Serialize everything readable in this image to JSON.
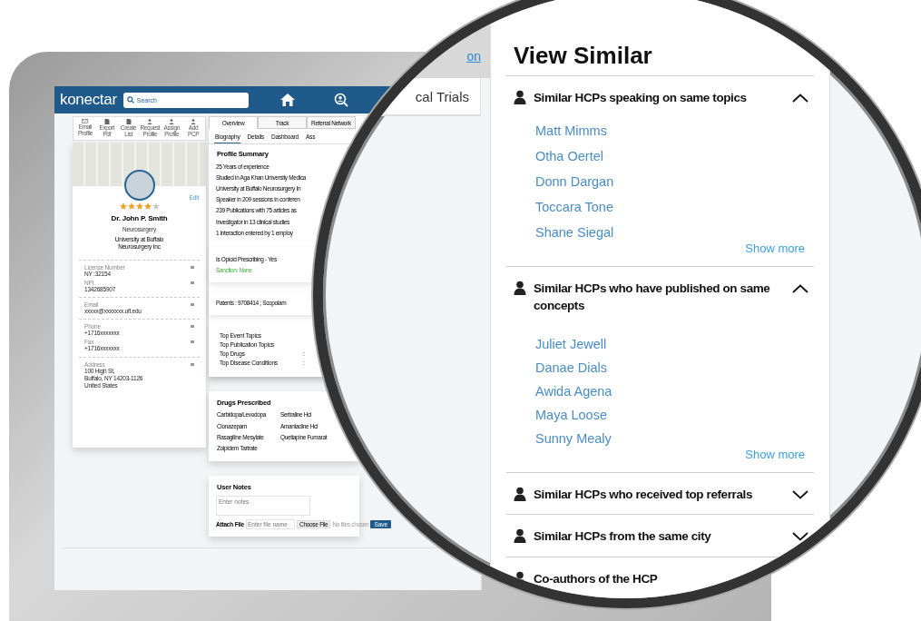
{
  "header": {
    "logo": "konectar",
    "search_placeholder": "Search"
  },
  "toolbar": [
    {
      "label": "Email Profile"
    },
    {
      "label": "Export Pdf"
    },
    {
      "label": "Create List"
    },
    {
      "label": "Request Profile"
    },
    {
      "label": "Assign Profile"
    },
    {
      "label": "Add PCP"
    }
  ],
  "profile": {
    "edit": "Edit",
    "stars": 4,
    "name": "Dr. John P. Smith",
    "specialty": "Neurosurgery",
    "organization": "University at Buffalo\nNeurosurgery Inc",
    "groups": [
      [
        {
          "label": "License Number",
          "value": "NY :32154"
        },
        {
          "label": "NPI",
          "value": "1342685907"
        }
      ],
      [
        {
          "label": "Email",
          "value": "xxxxx@xxxxxxx.ufl.edu"
        }
      ],
      [
        {
          "label": "Phone",
          "value": "+1716xxxxxxx"
        },
        {
          "label": "Fax",
          "value": "+1716xxxxxxx"
        }
      ],
      [
        {
          "label": "Address",
          "value": "100 High St,\nBuffalo, NY 14203-1126\nUnited States"
        }
      ]
    ]
  },
  "tabs": [
    {
      "label": "Overview",
      "selected": true
    },
    {
      "label": "Track",
      "selected": false
    },
    {
      "label": "Referral Network",
      "selected": false
    }
  ],
  "subtabs": [
    {
      "label": "Biography",
      "selected": true
    },
    {
      "label": "Details",
      "selected": false
    },
    {
      "label": "Dashboard",
      "selected": false
    },
    {
      "label": "Ass",
      "selected": false
    }
  ],
  "profile_summary": {
    "title": "Profile Summary",
    "items": [
      "25 Years of experience",
      "Studied in Aga Khan University Medica",
      "University at Buffalo Neurosurgery In",
      "Speaker in 209 sessions in conferen",
      "239 Publications with 75 articles as",
      "Investigator in 13 clinical studies",
      "1 interaction entered by 1 employ"
    ]
  },
  "flags": [
    {
      "text": "Is Opioid Prescribing - Yes",
      "kind": "normal"
    },
    {
      "text": "Sanction: None",
      "kind": "positive"
    }
  ],
  "patents": "Patents : 9708414 ; Scopolam",
  "top_lists": [
    {
      "label": "Top Event Topics"
    },
    {
      "label": "Top Publication Topics"
    },
    {
      "label": "Top Drugs",
      "value": ":"
    },
    {
      "label": "Top Disease Conditions",
      "value": ":"
    }
  ],
  "drugs": {
    "title": "Drugs Prescribed",
    "items": [
      "Carbidopa/Levodopa",
      "Sertraline Hcl",
      "Clonazepam",
      "Amantadine Hcl",
      "Rasagiline Mesylate",
      "Quetiapine Fumarat",
      "Zolpidem Tartrate"
    ]
  },
  "notes": {
    "title": "User Notes",
    "placeholder": "Enter notes",
    "attach_label": "Attach File",
    "file_placeholder": "Enter file name",
    "choose_button": "Choose File",
    "file_status": "No files chosen",
    "save_button": "Save"
  },
  "magnifier": {
    "link": "on",
    "heading": "cal Trials",
    "panel": {
      "title": "View Similar",
      "sections": [
        {
          "title": "Similar HCPs speaking on same topics",
          "expanded": true,
          "names": [
            "Matt Mimms",
            "Otha Oertel",
            "Donn Dargan",
            "Toccara Tone",
            "Shane Siegal"
          ],
          "more": "Show more"
        },
        {
          "title": "Similar HCPs who have published on same concepts",
          "expanded": true,
          "names": [
            "Juliet Jewell",
            "Danae Dials",
            "Awida Agena",
            "Maya Loose",
            "Sunny Mealy"
          ],
          "more": "Show more"
        },
        {
          "title": "Similar HCPs who received top referrals",
          "expanded": false
        },
        {
          "title": "Similar HCPs from the same city",
          "expanded": false
        },
        {
          "title": "Co-authors of the HCP"
        }
      ]
    }
  }
}
